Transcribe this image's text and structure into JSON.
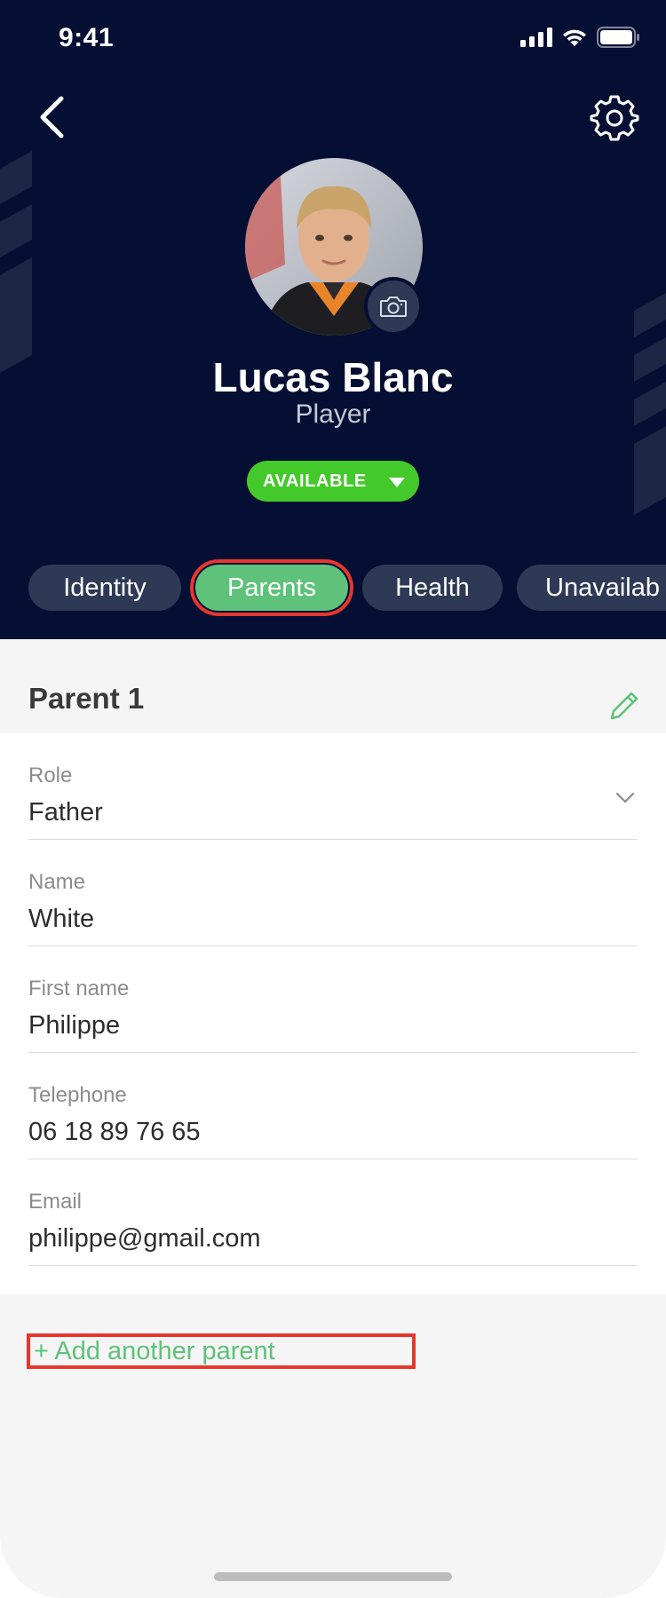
{
  "status_bar": {
    "time": "9:41",
    "signal_icon": "cellular-signal-icon",
    "wifi_icon": "wifi-icon",
    "battery_icon": "battery-icon"
  },
  "header": {
    "back_icon": "chevron-left-icon",
    "settings_icon": "gear-icon"
  },
  "profile": {
    "name": "Lucas Blanc",
    "role": "Player",
    "status": "AVAILABLE",
    "camera_icon": "camera-icon"
  },
  "tabs": [
    {
      "label": "Identity",
      "active": false
    },
    {
      "label": "Parents",
      "active": true
    },
    {
      "label": "Health",
      "active": false
    },
    {
      "label": "Unavailab",
      "active": false
    }
  ],
  "parent_section": {
    "title": "Parent 1",
    "edit_icon": "pencil-icon",
    "fields": [
      {
        "label": "Role",
        "value": "Father",
        "dropdown": true
      },
      {
        "label": "Name",
        "value": "White"
      },
      {
        "label": "First name",
        "value": "Philippe"
      },
      {
        "label": "Telephone",
        "value": "06 18 89 76 65"
      },
      {
        "label": "Email",
        "value": "philippe@gmail.com"
      }
    ]
  },
  "add_parent_label": "+ Add another parent",
  "colors": {
    "header_bg": "#040f33",
    "accent_green": "#5ec27a",
    "status_green": "#44c92a",
    "highlight_red": "#e8362c"
  }
}
